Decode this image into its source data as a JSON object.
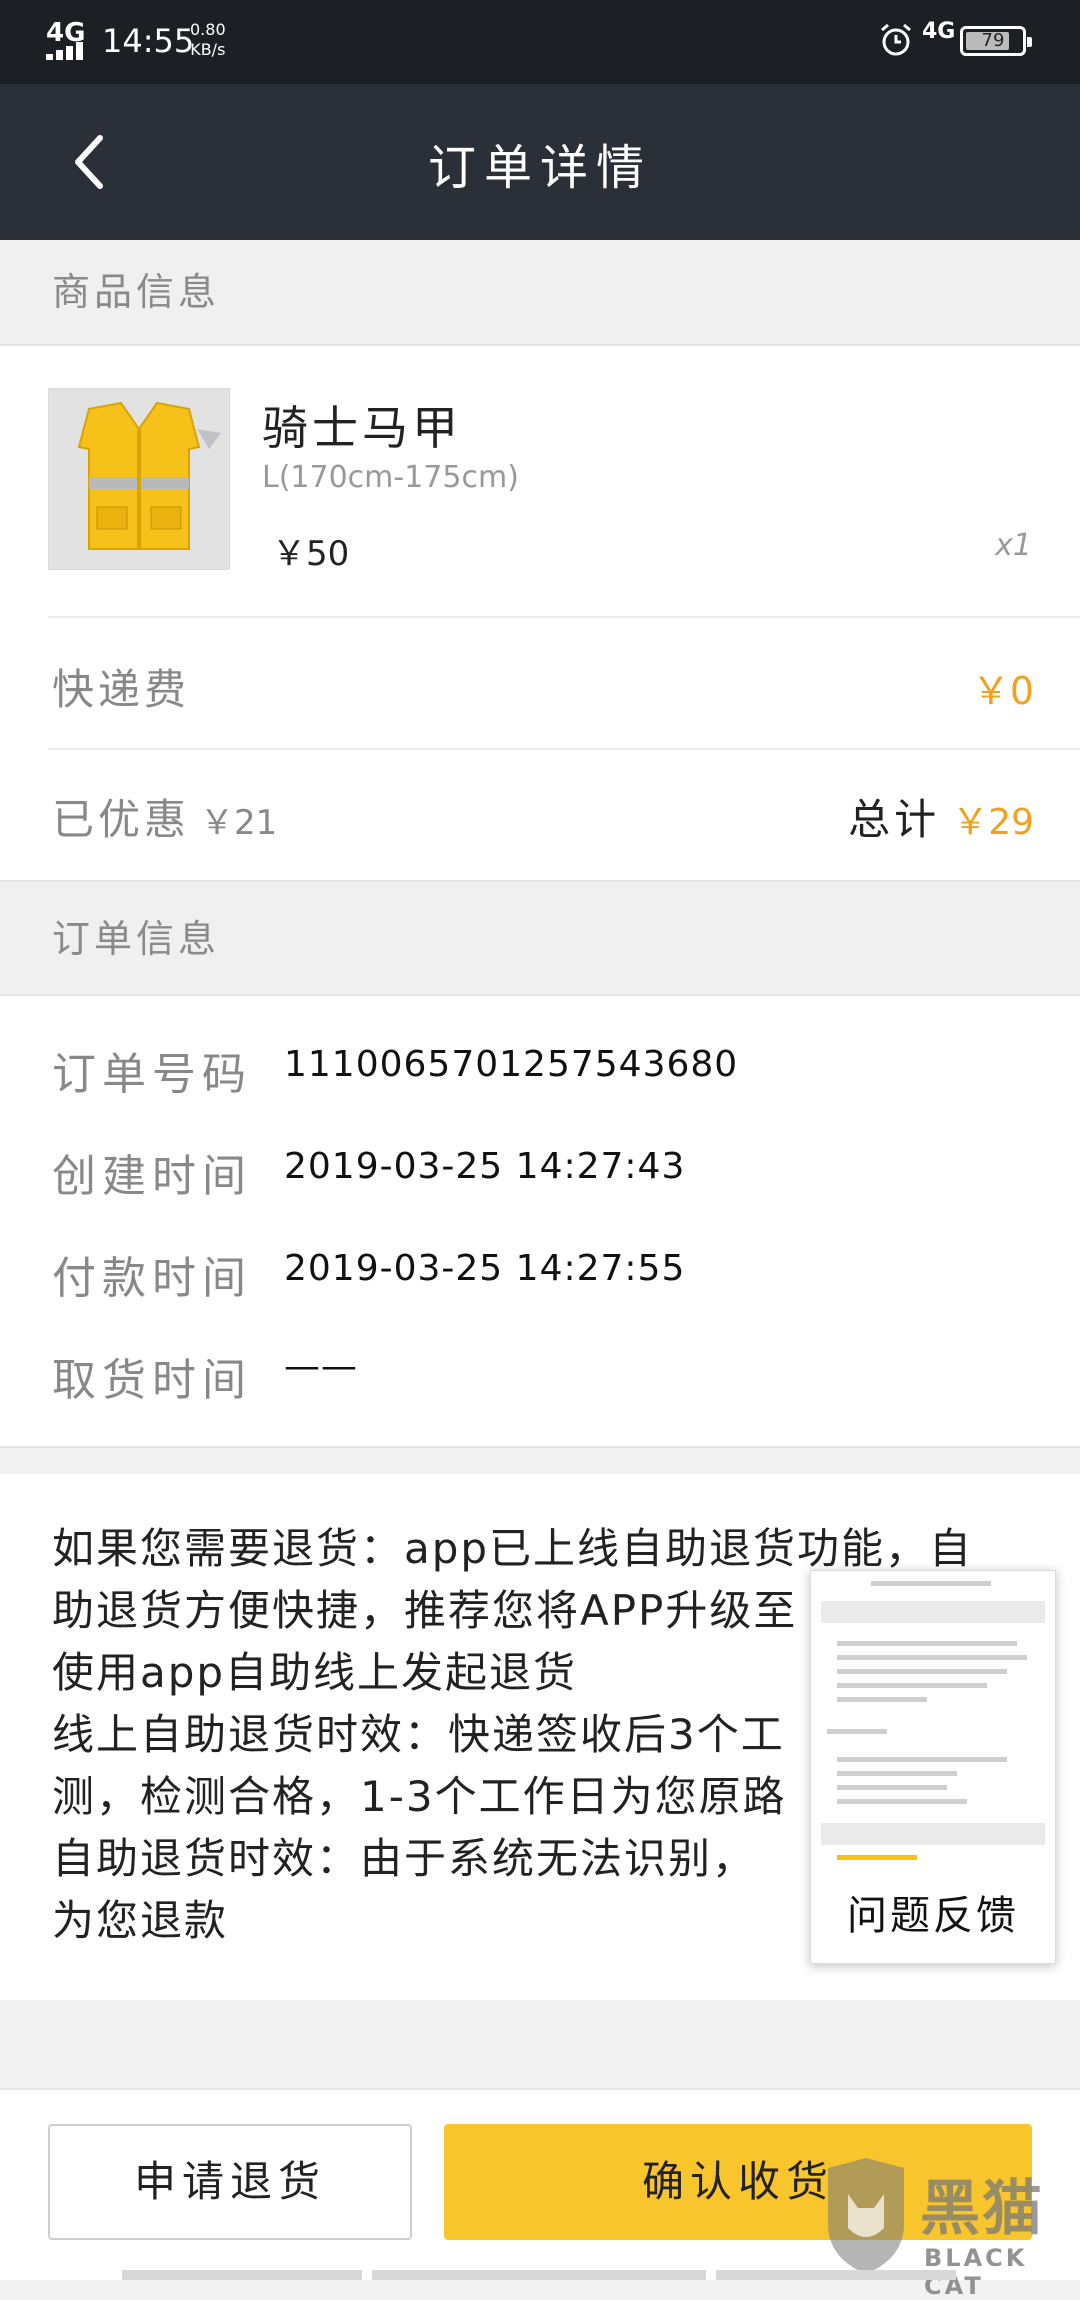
{
  "status_bar": {
    "network": "4G",
    "time": "14:55",
    "speed_value": "0.80",
    "speed_unit": "KB/s",
    "network_right": "4G",
    "battery": "79",
    "battery_level": 0.79
  },
  "header": {
    "title": "订单详情"
  },
  "product_section": {
    "heading": "商品信息",
    "name": "骑士马甲",
    "spec": "L(170cm-175cm)",
    "price": "￥50",
    "quantity": "x1"
  },
  "shipping": {
    "label": "快递费",
    "value": "￥0"
  },
  "summary": {
    "discount_label": "已优惠",
    "discount_value": "￥21",
    "total_label": "总计",
    "total_value": "￥29"
  },
  "order_section": {
    "heading": "订单信息",
    "rows": [
      {
        "label": "订单号码",
        "value": "1110065701257543680"
      },
      {
        "label": "创建时间",
        "value": "2019-03-25 14:27:43"
      },
      {
        "label": "付款时间",
        "value": "2019-03-25 14:27:55"
      },
      {
        "label": "取货时间",
        "value": "——"
      }
    ]
  },
  "notice": {
    "lines": [
      "如果您需要退货：app已上线自助退货功能，自",
      "助退货方便快捷，推荐您将APP升级至",
      "使用app自助线上发起退货",
      "线上自助退货时效：快递签收后3个工",
      "测，检测合格，1-3个工作日为您原路",
      "自助退货时效：由于系统无法识别，",
      "为您退款"
    ]
  },
  "feedback": {
    "label": "问题反馈"
  },
  "actions": {
    "return_label": "申请退货",
    "confirm_label": "确认收货"
  },
  "watermark": {
    "cn": "黑猫",
    "en": "BLACK CAT"
  },
  "colors": {
    "accent": "#f8c52d",
    "price_orange": "#f0a21f",
    "header_bg": "#2b2f38"
  }
}
